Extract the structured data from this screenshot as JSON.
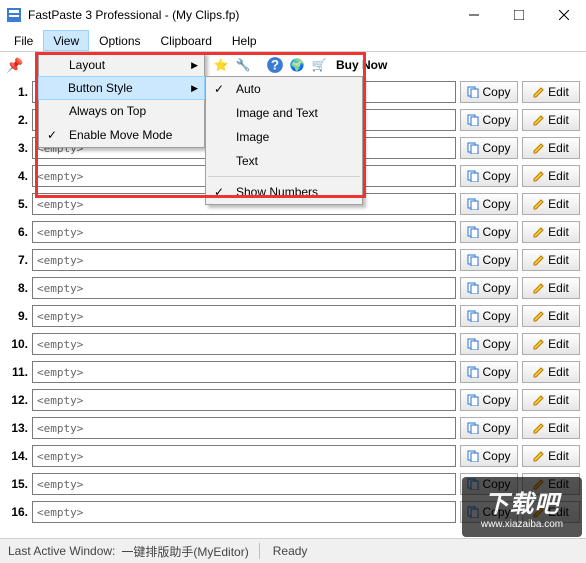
{
  "title": "FastPaste 3 Professional -  (My Clips.fp)",
  "menubar": [
    "File",
    "View",
    "Options",
    "Clipboard",
    "Help"
  ],
  "active_menu_index": 1,
  "buynow": "Buy Now",
  "view_menu": {
    "items": [
      {
        "label": "Layout",
        "submenu": true,
        "checked": false
      },
      {
        "label": "Button Style",
        "submenu": true,
        "checked": false,
        "hl": true
      },
      {
        "label": "Always on Top",
        "submenu": false,
        "checked": false
      },
      {
        "label": "Enable Move Mode",
        "submenu": false,
        "checked": true
      }
    ]
  },
  "button_style_menu": {
    "items_a": [
      {
        "label": "Auto",
        "checked": true
      },
      {
        "label": "Image and Text",
        "checked": false
      },
      {
        "label": "Image",
        "checked": false
      },
      {
        "label": "Text",
        "checked": false
      }
    ],
    "items_b": [
      {
        "label": "Show Numbers",
        "checked": true
      }
    ]
  },
  "rows": [
    {
      "n": "1.",
      "v": ""
    },
    {
      "n": "2.",
      "v": ""
    },
    {
      "n": "3.",
      "v": "<empty>"
    },
    {
      "n": "4.",
      "v": "<empty>"
    },
    {
      "n": "5.",
      "v": "<empty>"
    },
    {
      "n": "6.",
      "v": "<empty>"
    },
    {
      "n": "7.",
      "v": "<empty>"
    },
    {
      "n": "8.",
      "v": "<empty>"
    },
    {
      "n": "9.",
      "v": "<empty>"
    },
    {
      "n": "10.",
      "v": "<empty>"
    },
    {
      "n": "11.",
      "v": "<empty>"
    },
    {
      "n": "12.",
      "v": "<empty>"
    },
    {
      "n": "13.",
      "v": "<empty>"
    },
    {
      "n": "14.",
      "v": "<empty>"
    },
    {
      "n": "15.",
      "v": "<empty>"
    },
    {
      "n": "16.",
      "v": "<empty>"
    }
  ],
  "copy_label": "Copy",
  "edit_label": "Edit",
  "status": {
    "label": "Last Active Window:",
    "win": "一键排版助手(MyEditor)",
    "ready": "Ready"
  },
  "watermark": {
    "big": "下载吧",
    "url": "www.xiazaiba.com"
  }
}
